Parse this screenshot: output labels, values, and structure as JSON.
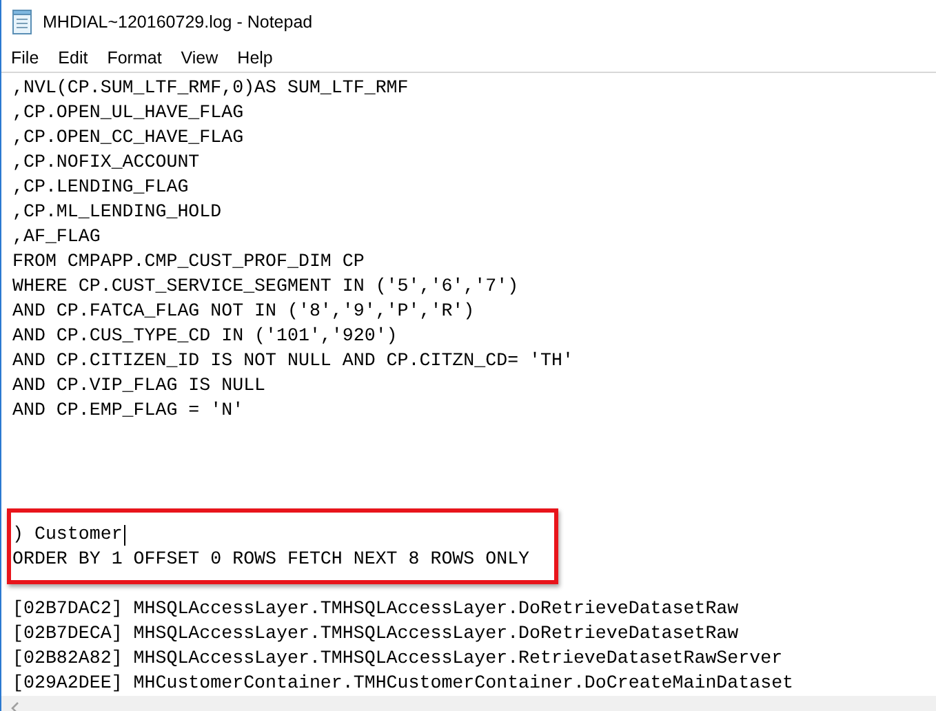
{
  "window": {
    "title": "MHDIAL~120160729.log - Notepad"
  },
  "menu": [
    "File",
    "Edit",
    "Format",
    "View",
    "Help"
  ],
  "editor": {
    "query_lines": [
      ",NVL(CP.SUM_LTF_RMF,0)AS SUM_LTF_RMF",
      ",CP.OPEN_UL_HAVE_FLAG",
      ",CP.OPEN_CC_HAVE_FLAG",
      ",CP.NOFIX_ACCOUNT",
      ",CP.LENDING_FLAG",
      ",CP.ML_LENDING_HOLD",
      ",AF_FLAG",
      "FROM CMPAPP.CMP_CUST_PROF_DIM CP",
      "WHERE CP.CUST_SERVICE_SEGMENT IN ('5','6','7')",
      "AND CP.FATCA_FLAG NOT IN ('8','9','P','R')",
      "AND CP.CUS_TYPE_CD IN ('101','920')",
      "AND CP.CITIZEN_ID IS NOT NULL AND CP.CITZN_CD= 'TH'",
      "AND CP.VIP_FLAG IS NULL",
      "AND CP.EMP_FLAG = 'N'"
    ],
    "highlighted_lines": [
      ") Customer",
      "ORDER BY 1 OFFSET 0 ROWS FETCH NEXT 8 ROWS ONLY"
    ],
    "trace_lines": [
      "[02B7DAC2] MHSQLAccessLayer.TMHSQLAccessLayer.DoRetrieveDatasetRaw",
      "[02B7DECA] MHSQLAccessLayer.TMHSQLAccessLayer.DoRetrieveDatasetRaw",
      "[02B82A82] MHSQLAccessLayer.TMHSQLAccessLayer.RetrieveDatasetRawServer",
      "[029A2DEE] MHCustomerContainer.TMHCustomerContainer.DoCreateMainDataset"
    ]
  }
}
